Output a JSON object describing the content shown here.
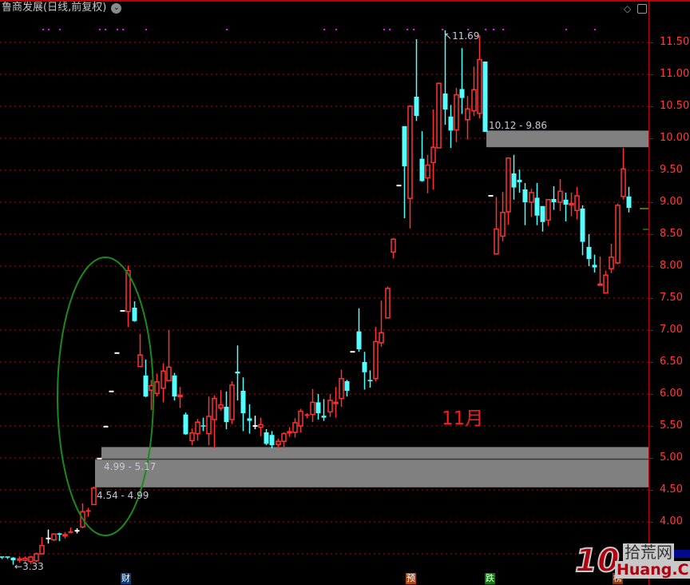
{
  "header": {
    "title": "鲁商发展(日线,前复权)",
    "chevron_icon": "chevron-down-circle-icon",
    "icons": [
      "diamond-icon",
      "panel-toggle-icon"
    ]
  },
  "colors": {
    "up": "#ff3232",
    "down": "#54ffff",
    "flat": "#ffffff",
    "grid": "#c00000",
    "zone": "#808080",
    "ellipse": "#1a8a1a",
    "signal": "#ff00ff"
  },
  "chart_data": {
    "type": "candlestick",
    "y_ticks": [
      "11.50",
      "11.00",
      "10.50",
      "10.00",
      "9.50",
      "9.00",
      "8.50",
      "8.00",
      "7.50",
      "7.00",
      "6.50",
      "6.00",
      "5.50",
      "5.00",
      "4.50",
      "4.00"
    ],
    "ylim": [
      3.3,
      11.7
    ],
    "grid": true,
    "ohlc": [
      [
        3.46,
        3.46,
        3.42,
        3.44
      ],
      [
        3.46,
        3.46,
        3.42,
        3.44
      ],
      [
        3.44,
        3.45,
        3.33,
        3.4
      ],
      [
        3.4,
        3.46,
        3.36,
        3.42
      ],
      [
        3.4,
        3.46,
        3.35,
        3.43
      ],
      [
        3.38,
        3.47,
        3.34,
        3.45
      ],
      [
        3.39,
        3.52,
        3.37,
        3.5
      ],
      [
        3.5,
        3.76,
        3.49,
        3.63
      ],
      [
        3.74,
        3.88,
        3.66,
        3.74
      ],
      [
        3.72,
        3.82,
        3.7,
        3.81
      ],
      [
        3.82,
        3.83,
        3.7,
        3.8
      ],
      [
        3.78,
        3.84,
        3.74,
        3.8
      ],
      [
        3.83,
        3.91,
        3.82,
        3.84
      ],
      [
        3.86,
        3.9,
        3.82,
        3.86
      ],
      [
        3.92,
        4.29,
        3.9,
        4.16
      ],
      [
        4.16,
        4.22,
        4.08,
        4.17
      ],
      [
        4.27,
        4.55,
        4.27,
        4.53
      ],
      [
        4.99,
        4.99,
        4.99,
        4.99
      ],
      [
        5.49,
        5.49,
        5.49,
        5.49
      ],
      [
        6.04,
        6.04,
        6.04,
        6.04
      ],
      [
        6.64,
        6.64,
        6.64,
        6.64
      ],
      [
        7.3,
        7.3,
        7.3,
        7.3
      ],
      [
        7.29,
        8.01,
        7.05,
        7.93
      ],
      [
        7.35,
        7.45,
        7.13,
        7.14
      ],
      [
        6.43,
        6.94,
        6.42,
        6.61
      ],
      [
        6.29,
        6.54,
        5.95,
        5.96
      ],
      [
        6.06,
        6.22,
        5.75,
        6.13
      ],
      [
        6.01,
        6.32,
        5.96,
        6.19
      ],
      [
        6.09,
        6.48,
        5.87,
        6.36
      ],
      [
        6.21,
        7.0,
        6.21,
        6.42
      ],
      [
        6.29,
        6.33,
        5.9,
        5.96
      ],
      [
        5.96,
        6.11,
        5.78,
        5.98
      ],
      [
        5.68,
        5.71,
        5.36,
        5.37
      ],
      [
        5.27,
        5.46,
        5.2,
        5.39
      ],
      [
        5.38,
        5.61,
        5.27,
        5.56
      ],
      [
        5.51,
        5.63,
        5.42,
        5.49
      ],
      [
        5.38,
        5.96,
        5.2,
        5.65
      ],
      [
        5.6,
        5.98,
        5.15,
        5.93
      ],
      [
        5.78,
        6.06,
        5.74,
        5.83
      ],
      [
        5.8,
        6.04,
        5.45,
        5.56
      ],
      [
        5.6,
        6.2,
        5.53,
        6.14
      ],
      [
        6.35,
        6.76,
        5.9,
        6.32
      ],
      [
        6.05,
        6.26,
        5.42,
        5.7
      ],
      [
        5.62,
        5.84,
        5.38,
        5.58
      ],
      [
        5.5,
        5.66,
        5.45,
        5.5
      ],
      [
        5.48,
        5.63,
        5.34,
        5.52
      ],
      [
        5.4,
        5.45,
        5.2,
        5.22
      ],
      [
        5.36,
        5.42,
        5.15,
        5.2
      ],
      [
        5.21,
        5.3,
        5.15,
        5.26
      ],
      [
        5.26,
        5.4,
        5.15,
        5.38
      ],
      [
        5.39,
        5.48,
        5.33,
        5.41
      ],
      [
        5.4,
        5.62,
        5.32,
        5.55
      ],
      [
        5.5,
        5.77,
        5.4,
        5.73
      ],
      [
        5.66,
        5.7,
        5.62,
        5.67
      ],
      [
        5.68,
        6.08,
        5.56,
        5.87
      ],
      [
        5.87,
        6.0,
        5.6,
        5.7
      ],
      [
        5.66,
        5.92,
        5.58,
        5.63
      ],
      [
        5.72,
        6.0,
        5.64,
        5.9
      ],
      [
        5.85,
        6.11,
        5.63,
        5.87
      ],
      [
        5.93,
        6.38,
        5.8,
        6.24
      ],
      [
        6.2,
        6.22,
        5.96,
        6.05
      ],
      [
        6.66,
        6.66,
        6.66,
        6.66
      ],
      [
        6.98,
        7.34,
        6.66,
        6.7
      ],
      [
        6.5,
        6.66,
        6.07,
        6.34
      ],
      [
        6.22,
        6.37,
        6.1,
        6.2
      ],
      [
        6.24,
        7.05,
        6.2,
        6.82
      ],
      [
        6.8,
        7.46,
        6.74,
        6.96
      ],
      [
        7.19,
        7.68,
        7.19,
        7.65
      ],
      [
        8.22,
        8.44,
        8.12,
        8.42
      ],
      [
        9.26,
        9.26,
        9.26,
        9.26
      ],
      [
        10.19,
        10.19,
        8.75,
        9.56
      ],
      [
        9.06,
        10.52,
        8.59,
        10.5
      ],
      [
        10.65,
        11.55,
        10.27,
        10.35
      ],
      [
        9.68,
        10.11,
        9.32,
        9.33
      ],
      [
        9.38,
        9.74,
        9.14,
        9.58
      ],
      [
        9.62,
        10.45,
        9.2,
        9.86
      ],
      [
        9.85,
        10.87,
        9.85,
        10.86
      ],
      [
        10.7,
        11.69,
        10.21,
        10.45
      ],
      [
        10.34,
        10.52,
        9.85,
        10.12
      ],
      [
        10.13,
        10.79,
        9.94,
        10.68
      ],
      [
        10.77,
        11.41,
        10.38,
        10.63
      ],
      [
        10.29,
        10.66,
        9.98,
        10.46
      ],
      [
        10.43,
        11.12,
        10.35,
        10.76
      ],
      [
        10.39,
        11.61,
        10.31,
        11.23
      ],
      [
        11.2,
        11.2,
        10.1,
        10.1
      ],
      [
        9.1,
        9.1,
        9.1,
        9.1
      ],
      [
        8.19,
        9.08,
        8.19,
        8.58
      ],
      [
        8.47,
        9.16,
        8.39,
        8.84
      ],
      [
        8.85,
        9.7,
        8.65,
        9.69
      ],
      [
        9.45,
        9.74,
        9.04,
        9.23
      ],
      [
        9.35,
        9.51,
        9.15,
        9.31
      ],
      [
        9.2,
        9.3,
        8.64,
        9.0
      ],
      [
        9.0,
        9.21,
        8.77,
        9.15
      ],
      [
        9.07,
        9.3,
        8.64,
        8.79
      ],
      [
        8.94,
        8.94,
        8.54,
        8.69
      ],
      [
        8.72,
        9.05,
        8.63,
        9.04
      ],
      [
        9.05,
        9.25,
        8.88,
        9.0
      ],
      [
        9.0,
        9.36,
        8.86,
        9.17
      ],
      [
        9.04,
        9.15,
        8.7,
        8.96
      ],
      [
        8.96,
        9.15,
        8.78,
        8.98
      ],
      [
        8.87,
        9.24,
        8.73,
        9.1
      ],
      [
        8.9,
        8.95,
        8.17,
        8.38
      ],
      [
        8.3,
        8.5,
        8.0,
        8.11
      ],
      [
        8.02,
        8.18,
        7.9,
        7.98
      ],
      [
        7.7,
        8.15,
        7.7,
        7.72
      ],
      [
        7.58,
        7.93,
        7.57,
        7.86
      ],
      [
        7.96,
        8.35,
        7.89,
        8.14
      ],
      [
        8.05,
        8.98,
        8.03,
        8.95
      ],
      [
        9.09,
        9.85,
        9.04,
        9.52
      ],
      [
        9.09,
        9.24,
        8.84,
        8.91
      ]
    ],
    "zones": [
      {
        "low": 9.86,
        "high": 10.12,
        "label": "10.12 - 9.86"
      },
      {
        "low": 4.99,
        "high": 5.17,
        "label": "4.99 - 5.17"
      },
      {
        "low": 4.54,
        "high": 4.99,
        "label": "4.54 - 4.99"
      }
    ],
    "annotations": {
      "high_label": "11.69",
      "low_label": "3.33",
      "month_label": "11月"
    }
  },
  "markers": [
    {
      "text": "财",
      "color": "#0a3a7a"
    },
    {
      "text": "预",
      "color": "#b0440a"
    },
    {
      "text": "跌",
      "color": "#0a7a0a"
    },
    {
      "text": "榜",
      "color": "#8a3a10"
    }
  ],
  "watermark": {
    "number": "10",
    "cn": "拾荒网",
    "en": "Huang.CN"
  }
}
